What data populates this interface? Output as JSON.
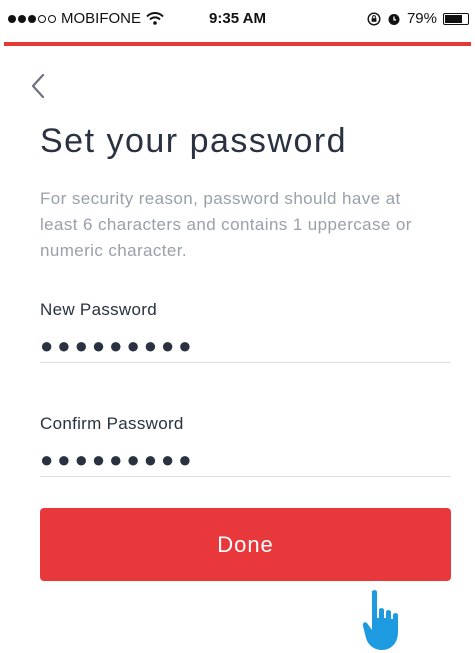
{
  "status_bar": {
    "carrier": "MOBIFONE",
    "time": "9:35 AM",
    "battery": "79%",
    "battery_level": 0.79
  },
  "screen": {
    "title": "Set your password",
    "description": "For security reason, password should have at least 6 characters and contains 1 uppercase or numeric character.",
    "new_password": {
      "label": "New Password",
      "value": "●●●●●●●●●"
    },
    "confirm_password": {
      "label": "Confirm Password",
      "value": "●●●●●●●●●"
    },
    "done_label": "Done"
  },
  "colors": {
    "accent": "#e8383c",
    "text": "#2a3140",
    "muted": "#9aa0aa",
    "cursor": "#1e9be0"
  },
  "icons": {
    "back": "chevron-left-icon",
    "wifi": "wifi-icon",
    "rotation_lock": "rotation-lock-icon",
    "alarm": "alarm-icon",
    "battery": "battery-icon",
    "pointer": "hand-pointer-icon"
  }
}
